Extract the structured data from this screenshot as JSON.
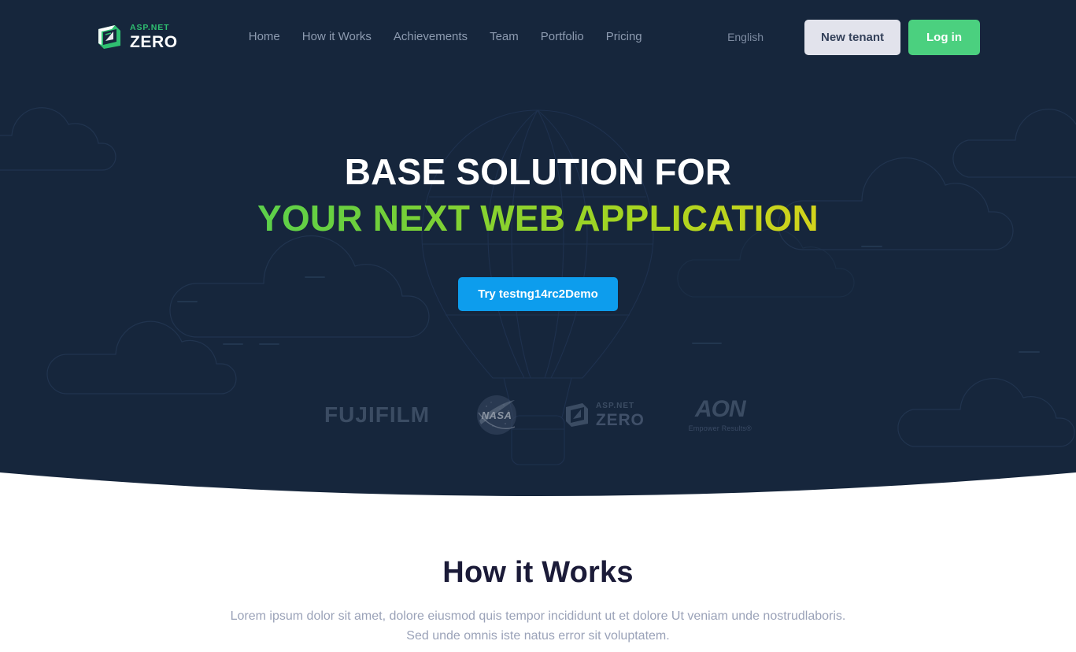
{
  "colors": {
    "hero_bg": "#16263c",
    "accent_green": "#4bd07f",
    "accent_blue": "#0d9ded",
    "brand_green": "#2fbf71",
    "nav_link": "#8d9bb0",
    "tenant_btn_bg": "#e2e3ec",
    "heading_dark": "#1b1b38",
    "muted_text": "#9aa2b8",
    "gradient_start": "#32d46f",
    "gradient_end": "#f5c518"
  },
  "navbar": {
    "brand": {
      "icon": "aspnetzero-logo-icon",
      "top_text": "ASP.NET",
      "bottom_text": "ZERO"
    },
    "links": [
      {
        "label": "Home"
      },
      {
        "label": "How it Works"
      },
      {
        "label": "Achievements"
      },
      {
        "label": "Team"
      },
      {
        "label": "Portfolio"
      },
      {
        "label": "Pricing"
      }
    ],
    "language": "English",
    "new_tenant_label": "New tenant",
    "login_label": "Log in"
  },
  "hero": {
    "title_line1": "BASE SOLUTION FOR",
    "title_line2": "YOUR NEXT WEB APPLICATION",
    "cta_label": "Try testng14rc2Demo",
    "clients": [
      {
        "name": "fujifilm-logo",
        "text": "FUJIFILM"
      },
      {
        "name": "nasa-logo",
        "text": "NASA"
      },
      {
        "name": "aspnetzero-client-logo",
        "top_text": "ASP.NET",
        "bottom_text": "ZERO"
      },
      {
        "name": "aon-logo",
        "text": "AON",
        "sub_text": "Empower Results®"
      }
    ]
  },
  "how_it_works": {
    "title": "How it Works",
    "desc_line1": "Lorem ipsum dolor sit amet, dolore eiusmod quis tempor incididunt ut et dolore Ut veniam unde nostrudlaboris.",
    "desc_line2": "Sed unde omnis iste natus error sit voluptatem."
  }
}
